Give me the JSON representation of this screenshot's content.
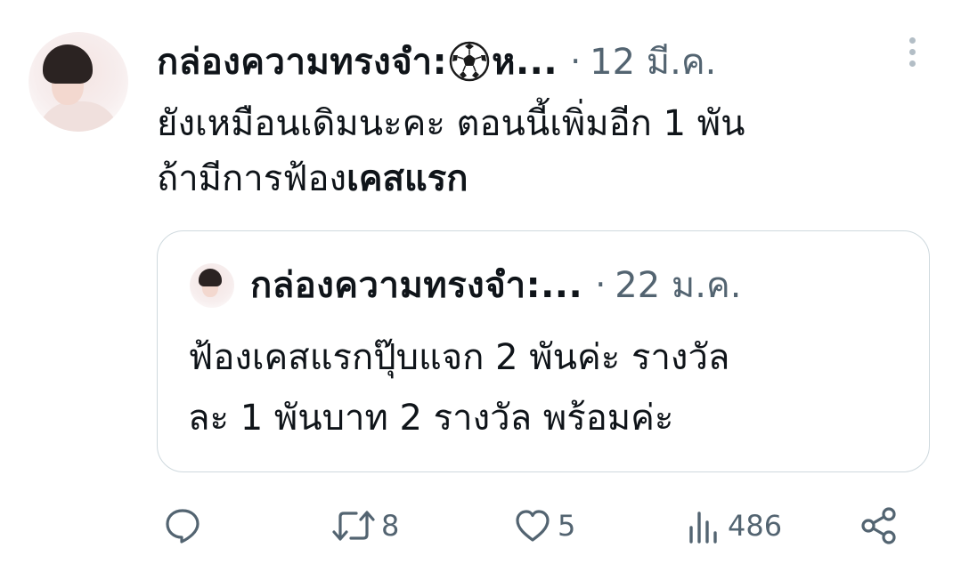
{
  "tweet": {
    "author_name": "กล่องความทรงจำ:",
    "author_name_trail": "ห...",
    "separator": "·",
    "date": "12 มี.ค.",
    "text_line1": "ยังเหมือนเดิมนะคะ ตอนนี้เพิ่มอีก 1 พัน",
    "text_line2_prefix": "ถ้ามีการฟ้อง",
    "text_line2_bold": "เคสแรก"
  },
  "quoted": {
    "author_name": "กล่องความทรงจำ:...",
    "separator": "·",
    "date": "22 ม.ค.",
    "text_line1": "ฟ้องเคสแรกปุ๊บแจก 2 พันค่ะ รางวัล",
    "text_line2": "ละ 1 พันบาท 2 รางวัล พร้อมค่ะ"
  },
  "actions": {
    "reply_icon": "reply-icon",
    "retweet_icon": "retweet-icon",
    "retweet_count": "8",
    "like_icon": "heart-icon",
    "like_count": "5",
    "views_icon": "views-icon",
    "views_count": "486",
    "share_icon": "share-icon"
  },
  "colors": {
    "text": "#0f1419",
    "secondary": "#536471",
    "border": "#cfd9de"
  }
}
